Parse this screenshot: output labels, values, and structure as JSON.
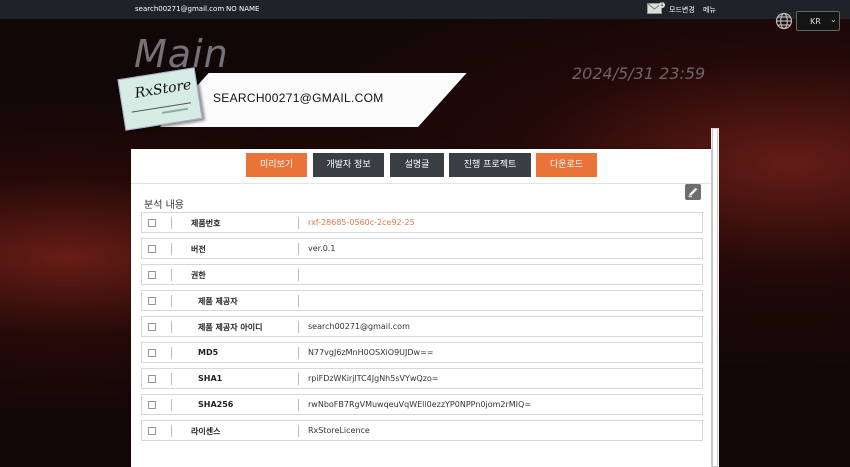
{
  "topbar": {
    "user_email": "search00271@gmail.com",
    "user_name": "NO NAME",
    "mail_badge": "1",
    "mode_change": "모드변경",
    "menu": "메뉴"
  },
  "language": {
    "selected": "KR"
  },
  "header": {
    "title": "Main",
    "datetime": "2024/5/31 23:59",
    "email": "SEARCH00271@GMAIL.COM",
    "logo_text": "RxStore"
  },
  "tabs": [
    {
      "label": "미리보기",
      "color": "#ea7339"
    },
    {
      "label": "개발자 정보",
      "color": "#3a3f44"
    },
    {
      "label": "설명글",
      "color": "#3a3f44"
    },
    {
      "label": "진행 프로젝트",
      "color": "#3a3f44"
    },
    {
      "label": "다운로드",
      "color": "#ea7339"
    }
  ],
  "analysis": {
    "title": "분석 내용",
    "rows": [
      {
        "label": "제품번호",
        "value": "rxf-28685-0560c-2ce92-25"
      },
      {
        "label": "버전",
        "value": "ver.0.1"
      },
      {
        "label": "권한",
        "value": ""
      },
      {
        "label": "제품 제공자",
        "value": ""
      },
      {
        "label": "제품 제공자 아이디",
        "value": "search00271@gmail.com"
      },
      {
        "label": "MD5",
        "value": "N77vgJ6zMnH0OSXiO9UJDw=="
      },
      {
        "label": "SHA1",
        "value": "rpiFDzWKirjlTC4JgNh5sVYwQzo="
      },
      {
        "label": "SHA256",
        "value": "rwNboFB7RgVMuwqeuVqWEli0ezzYP0NPPn0jom2rMIQ="
      },
      {
        "label": "라이센스",
        "value": "RxStoreLicence"
      }
    ]
  },
  "colors": {
    "accent": "#ea7339",
    "dark_button": "#3a3f44",
    "topbar": "#1f2329"
  }
}
